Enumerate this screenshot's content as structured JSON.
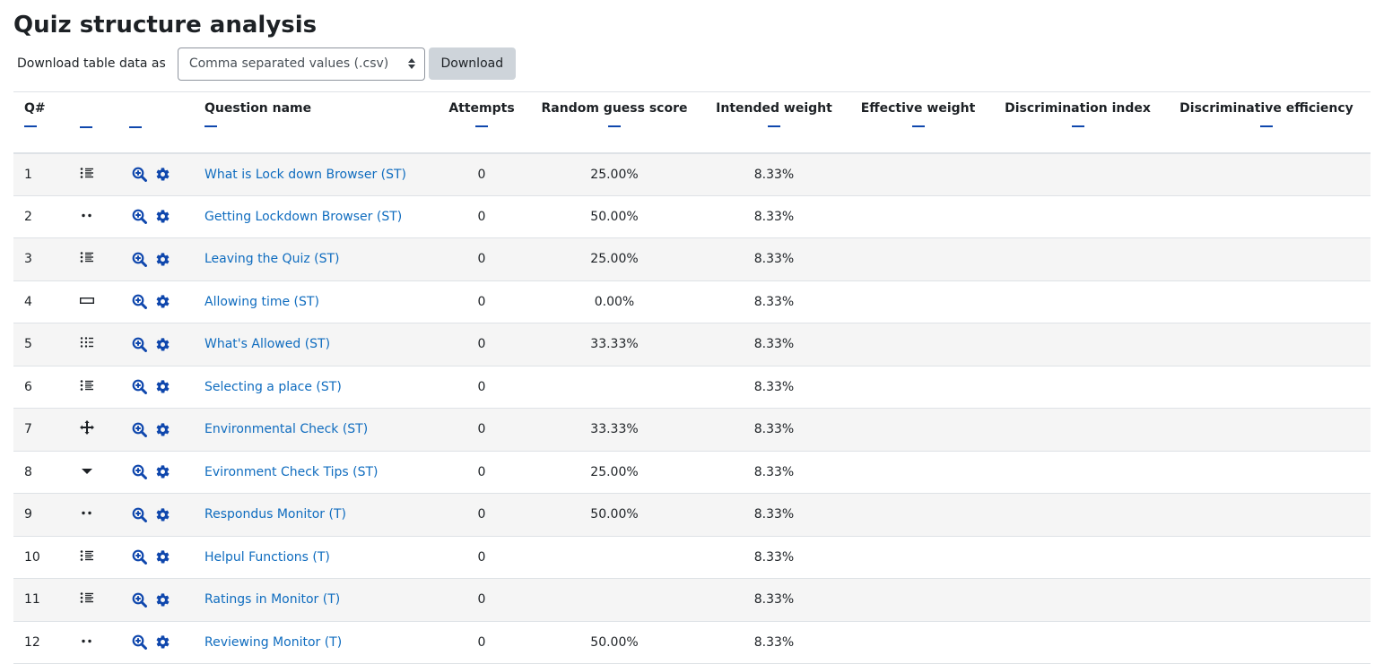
{
  "page": {
    "title": "Quiz structure analysis"
  },
  "download": {
    "label": "Download table data as",
    "selected_format": "Comma separated values (.csv)",
    "button_label": "Download"
  },
  "table": {
    "headers": {
      "qnum": "Q#",
      "name": "Question name",
      "attempts": "Attempts",
      "random_guess": "Random guess score",
      "intended_weight": "Intended weight",
      "effective_weight": "Effective weight",
      "discrimination_index": "Discrimination index",
      "discriminative_efficiency": "Discriminative efficiency"
    },
    "rows": [
      {
        "num": "1",
        "type_icon": "multichoice-icon",
        "name": "What is Lock down Browser (ST)",
        "attempts": "0",
        "random_guess": "25.00%",
        "intended_weight": "8.33%"
      },
      {
        "num": "2",
        "type_icon": "truefalse-icon",
        "name": "Getting Lockdown Browser (ST)",
        "attempts": "0",
        "random_guess": "50.00%",
        "intended_weight": "8.33%"
      },
      {
        "num": "3",
        "type_icon": "multichoice-icon",
        "name": "Leaving the Quiz (ST)",
        "attempts": "0",
        "random_guess": "25.00%",
        "intended_weight": "8.33%"
      },
      {
        "num": "4",
        "type_icon": "shortanswer-icon",
        "name": "Allowing time (ST)",
        "attempts": "0",
        "random_guess": "0.00%",
        "intended_weight": "8.33%"
      },
      {
        "num": "5",
        "type_icon": "match-icon",
        "name": "What's Allowed (ST)",
        "attempts": "0",
        "random_guess": "33.33%",
        "intended_weight": "8.33%"
      },
      {
        "num": "6",
        "type_icon": "multichoice-icon",
        "name": "Selecting a place (ST)",
        "attempts": "0",
        "random_guess": "",
        "intended_weight": "8.33%"
      },
      {
        "num": "7",
        "type_icon": "ddwtos-icon",
        "name": "Environmental Check (ST)",
        "attempts": "0",
        "random_guess": "33.33%",
        "intended_weight": "8.33%"
      },
      {
        "num": "8",
        "type_icon": "gapselect-icon",
        "name": "Evironment Check Tips (ST)",
        "attempts": "0",
        "random_guess": "25.00%",
        "intended_weight": "8.33%"
      },
      {
        "num": "9",
        "type_icon": "truefalse-icon",
        "name": "Respondus Monitor (T)",
        "attempts": "0",
        "random_guess": "50.00%",
        "intended_weight": "8.33%"
      },
      {
        "num": "10",
        "type_icon": "multichoice-icon",
        "name": "Helpul Functions (T)",
        "attempts": "0",
        "random_guess": "",
        "intended_weight": "8.33%"
      },
      {
        "num": "11",
        "type_icon": "multichoice-icon",
        "name": "Ratings in Monitor (T)",
        "attempts": "0",
        "random_guess": "",
        "intended_weight": "8.33%"
      },
      {
        "num": "12",
        "type_icon": "truefalse-icon",
        "name": "Reviewing Monitor (T)",
        "attempts": "0",
        "random_guess": "50.00%",
        "intended_weight": "8.33%"
      }
    ]
  },
  "colors": {
    "link": "#0f6cbf",
    "icon": "#0f47ad",
    "stripe": "#f5f5f5"
  }
}
